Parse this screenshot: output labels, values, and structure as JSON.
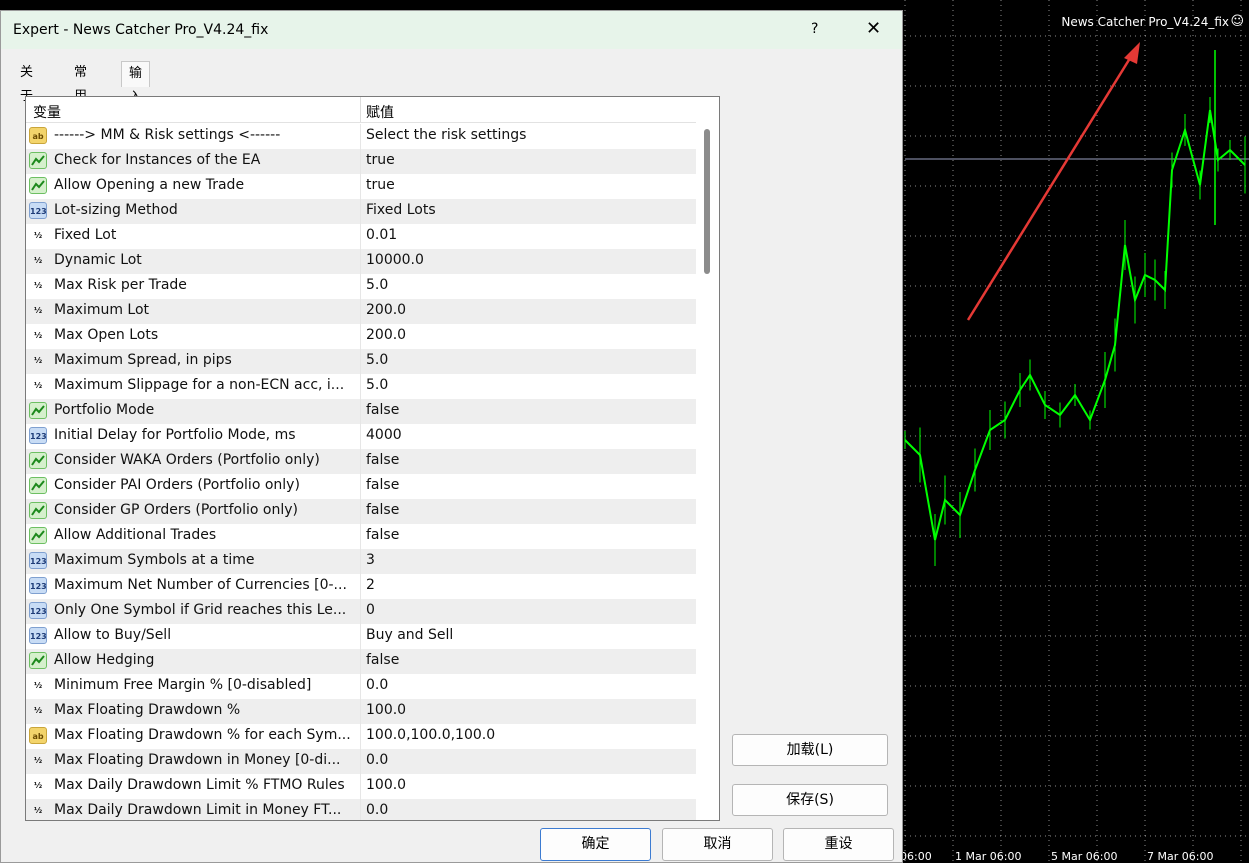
{
  "chart": {
    "title": "News Catcher Pro_V4.24_fix",
    "smiley": "☺",
    "date_labels": [
      "06:00",
      "1 Mar 06:00",
      "5 Mar 06:00",
      "7 Mar 06:00"
    ],
    "line_color": "#00ff00",
    "grid_color": "#ffffff",
    "annotation_arrow_color": "#e53935"
  },
  "dialog": {
    "title": "Expert - News Catcher Pro_V4.24_fix",
    "help_label": "?",
    "close_label": "✕",
    "tabs": [
      {
        "label": "关于"
      },
      {
        "label": "常用"
      },
      {
        "label": "输入参数"
      }
    ],
    "active_tab": "输入参数",
    "columns": {
      "variable": "变量",
      "value": "赋值"
    },
    "params": [
      {
        "type": "text",
        "icon": "ab",
        "name": "------> MM & Risk settings <------",
        "value": "Select the risk settings"
      },
      {
        "type": "bool",
        "icon": "",
        "name": "Check for Instances of the EA",
        "value": "true"
      },
      {
        "type": "bool",
        "icon": "",
        "name": "Allow Opening a new Trade",
        "value": "true"
      },
      {
        "type": "int",
        "icon": "123",
        "name": "Lot-sizing Method",
        "value": "Fixed Lots"
      },
      {
        "type": "double",
        "icon": "½",
        "name": "Fixed Lot",
        "value": "0.01"
      },
      {
        "type": "double",
        "icon": "½",
        "name": "Dynamic Lot",
        "value": "10000.0"
      },
      {
        "type": "double",
        "icon": "½",
        "name": "Max Risk per Trade",
        "value": "5.0"
      },
      {
        "type": "double",
        "icon": "½",
        "name": "Maximum Lot",
        "value": "200.0"
      },
      {
        "type": "double",
        "icon": "½",
        "name": "Max Open Lots",
        "value": "200.0"
      },
      {
        "type": "double",
        "icon": "½",
        "name": "Maximum Spread, in pips",
        "value": "5.0"
      },
      {
        "type": "double",
        "icon": "½",
        "name": "Maximum Slippage for a non-ECN acc, i...",
        "value": "5.0"
      },
      {
        "type": "bool",
        "icon": "",
        "name": "Portfolio Mode",
        "value": "false"
      },
      {
        "type": "int",
        "icon": "123",
        "name": "Initial Delay for Portfolio Mode, ms",
        "value": "4000"
      },
      {
        "type": "bool",
        "icon": "",
        "name": "Consider WAKA Orders (Portfolio only)",
        "value": "false"
      },
      {
        "type": "bool",
        "icon": "",
        "name": "Consider PAI Orders (Portfolio only)",
        "value": "false"
      },
      {
        "type": "bool",
        "icon": "",
        "name": "Consider GP Orders (Portfolio only)",
        "value": "false"
      },
      {
        "type": "bool",
        "icon": "",
        "name": "Allow Additional Trades",
        "value": "false"
      },
      {
        "type": "int",
        "icon": "123",
        "name": "Maximum Symbols at a time",
        "value": "3"
      },
      {
        "type": "int",
        "icon": "123",
        "name": "Maximum Net Number of Currencies [0-...",
        "value": "2"
      },
      {
        "type": "int",
        "icon": "123",
        "name": "Only One Symbol if Grid reaches this Le...",
        "value": "0"
      },
      {
        "type": "int",
        "icon": "123",
        "name": "Allow to Buy/Sell",
        "value": "Buy and Sell"
      },
      {
        "type": "bool",
        "icon": "",
        "name": "Allow Hedging",
        "value": "false"
      },
      {
        "type": "double",
        "icon": "½",
        "name": "Minimum Free Margin % [0-disabled]",
        "value": "0.0"
      },
      {
        "type": "double",
        "icon": "½",
        "name": "Max Floating Drawdown %",
        "value": "100.0"
      },
      {
        "type": "text",
        "icon": "ab",
        "name": "Max Floating Drawdown % for each Sym...",
        "value": "100.0,100.0,100.0"
      },
      {
        "type": "double",
        "icon": "½",
        "name": "Max Floating Drawdown in Money [0-di...",
        "value": "0.0"
      },
      {
        "type": "double",
        "icon": "½",
        "name": "Max Daily Drawdown Limit % FTMO Rules",
        "value": "100.0"
      },
      {
        "type": "double",
        "icon": "½",
        "name": "Max Daily Drawdown Limit in Money FT...",
        "value": "0.0"
      }
    ],
    "buttons": {
      "load": "加载(L)",
      "save": "保存(S)",
      "ok": "确定",
      "cancel": "取消",
      "reset": "重设"
    }
  }
}
